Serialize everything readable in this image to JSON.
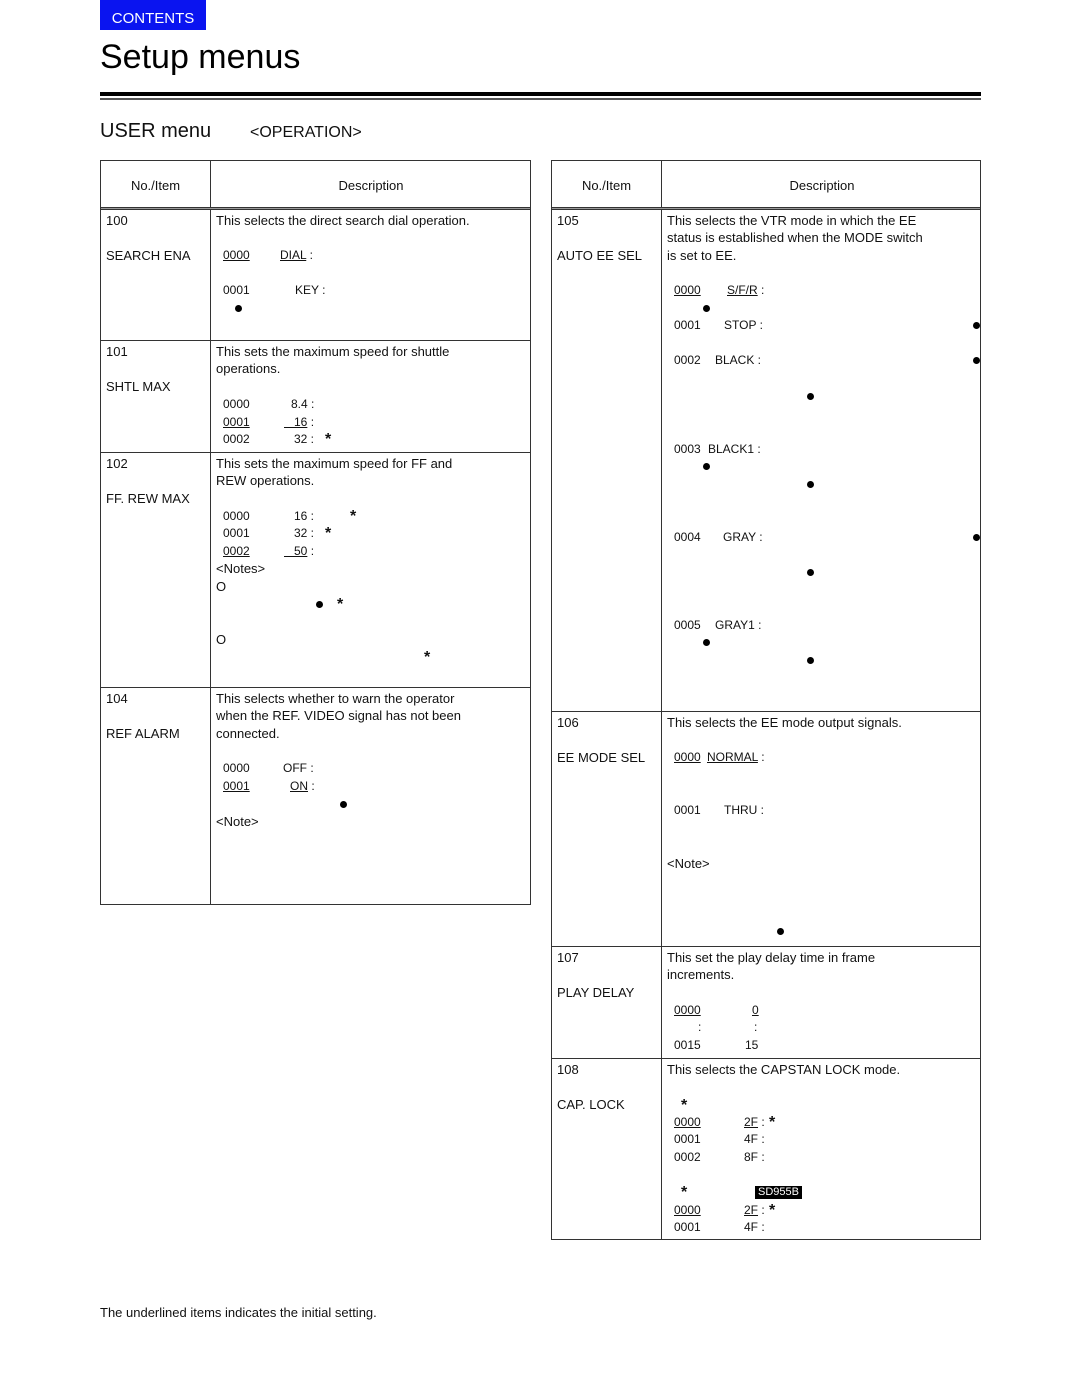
{
  "nav": {
    "contents_label": "CONTENTS",
    "contents_color": "#0a14f0"
  },
  "page": {
    "title": "Setup menus"
  },
  "section": {
    "title": "USER menu",
    "subtitle": "<OPERATION>"
  },
  "table_header": {
    "col1": "No./Item",
    "col2": "Description"
  },
  "left_table": {
    "rows": [
      {
        "no": "100",
        "item": "SEARCH ENA",
        "description": [
          "This selects the direct search dial operation."
        ],
        "options": [
          {
            "code": "0000",
            "label": "DIAL :",
            "initial": true
          },
          {
            "code": "0001",
            "label": "KEY :",
            "initial": false
          }
        ]
      },
      {
        "no": "101",
        "item": "SHTL MAX",
        "description": [
          "This sets the maximum speed for shuttle",
          "operations."
        ],
        "options": [
          {
            "code": "0000",
            "label": "8.4 :",
            "initial": false
          },
          {
            "code": "0001",
            "label": "16 :",
            "initial": true
          },
          {
            "code": "0002",
            "label": "32 :",
            "initial": false
          }
        ]
      },
      {
        "no": "102",
        "item": "FF. REW MAX",
        "description": [
          "This sets the maximum speed for FF and",
          "REW operations."
        ],
        "options": [
          {
            "code": "0000",
            "label": "16 :",
            "initial": false
          },
          {
            "code": "0001",
            "label": "32 :",
            "initial": false
          },
          {
            "code": "0002",
            "label": "50 :",
            "initial": true
          }
        ],
        "notes_label": "<Notes>",
        "note_markers": [
          "O",
          "O"
        ]
      },
      {
        "no": "104",
        "item": "REF ALARM",
        "description": [
          "This selects whether to warn the operator",
          "when the REF. VIDEO signal has not been",
          "connected."
        ],
        "options": [
          {
            "code": "0000",
            "label": "OFF :",
            "initial": false
          },
          {
            "code": "0001",
            "label": "ON :",
            "initial": true
          }
        ],
        "note_label": "<Note>"
      }
    ]
  },
  "right_table": {
    "rows": [
      {
        "no": "105",
        "item": "AUTO EE SEL",
        "description": [
          "This selects the VTR mode in which the EE",
          "status is established when the MODE switch",
          "is set to EE."
        ],
        "options": [
          {
            "code": "0000",
            "label": "S/F/R :",
            "initial": true
          },
          {
            "code": "0001",
            "label": "STOP :",
            "initial": false
          },
          {
            "code": "0002",
            "label": "BLACK :",
            "initial": false
          },
          {
            "code": "0003",
            "label": "BLACK1 :",
            "initial": false
          },
          {
            "code": "0004",
            "label": "GRAY :",
            "initial": false
          },
          {
            "code": "0005",
            "label": "GRAY1 :",
            "initial": false
          }
        ]
      },
      {
        "no": "106",
        "item": "EE MODE SEL",
        "description": [
          "This selects the EE mode output signals."
        ],
        "options": [
          {
            "code": "0000",
            "label": "NORMAL :",
            "initial": true
          },
          {
            "code": "0001",
            "label": "THRU :",
            "initial": false
          }
        ],
        "note_label": "<Note>"
      },
      {
        "no": "107",
        "item": "PLAY DELAY",
        "description": [
          "This set the play delay time in frame",
          "increments."
        ],
        "options": [
          {
            "code": "0000",
            "label": "0",
            "initial": true
          },
          {
            "code": ":",
            "label": ":",
            "initial": false
          },
          {
            "code": "0015",
            "label": "15",
            "initial": false
          }
        ]
      },
      {
        "no": "108",
        "item": "CAP. LOCK",
        "description": [
          "This selects the CAPSTAN LOCK mode."
        ],
        "options_a": [
          {
            "code": "0000",
            "label": "2F :",
            "initial": true
          },
          {
            "code": "0001",
            "label": "4F :",
            "initial": false
          },
          {
            "code": "0002",
            "label": "8F :",
            "initial": false
          }
        ],
        "model_badge": "SD955B",
        "options_b": [
          {
            "code": "0000",
            "label": "2F :",
            "initial": true
          },
          {
            "code": "0001",
            "label": "4F :",
            "initial": false
          }
        ]
      }
    ]
  },
  "footnote": "The underlined items indicates the initial setting."
}
